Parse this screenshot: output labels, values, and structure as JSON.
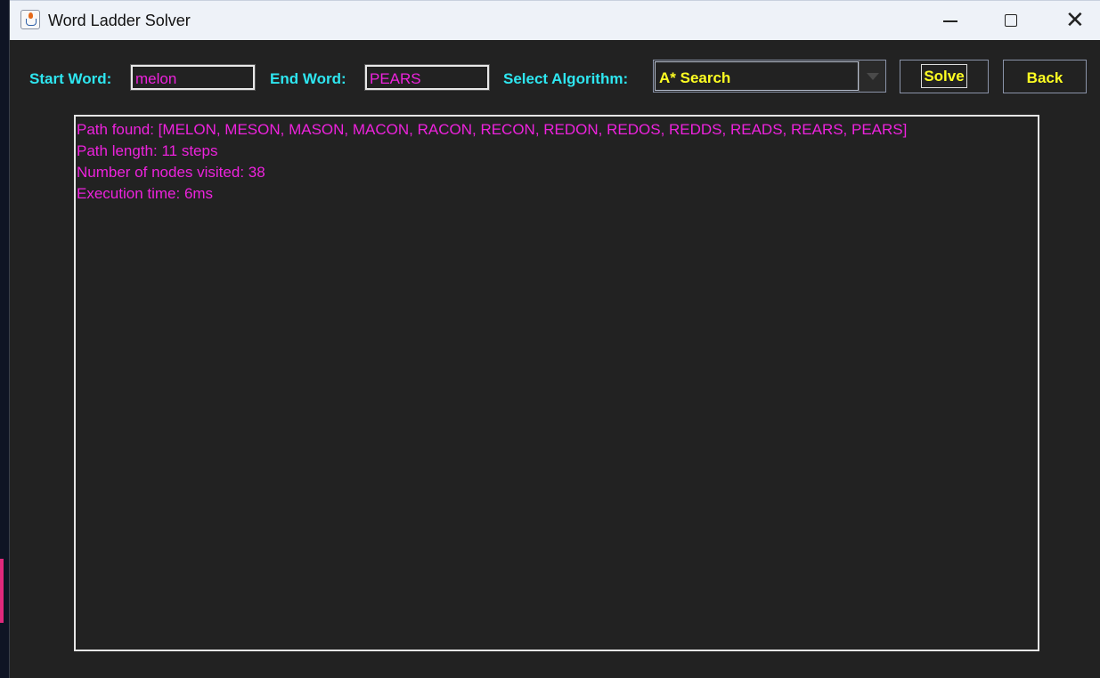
{
  "window": {
    "title": "Word Ladder Solver",
    "icon": "java-coffee-cup-icon",
    "controls": [
      "minimize-icon",
      "maximize-icon",
      "close-icon"
    ]
  },
  "form": {
    "start_label": "Start Word:",
    "start_value": "melon",
    "end_label": "End Word:",
    "end_value": "PEARS",
    "algorithm_label": "Select Algorithm:",
    "algorithm_selected": "A* Search",
    "solve_label": "Solve",
    "back_label": "Back"
  },
  "output": {
    "lines": [
      "Path found: [MELON, MESON, MASON, MACON, RACON, RECON, REDON, REDOS, REDDS, READS, REARS, PEARS]",
      "Path length: 11 steps",
      "Number of nodes visited: 38",
      "Execution time: 6ms"
    ]
  },
  "colors": {
    "label": "#2ee6f0",
    "input_text": "#ee22dd",
    "button_text": "#ffff22",
    "background": "#222222"
  }
}
